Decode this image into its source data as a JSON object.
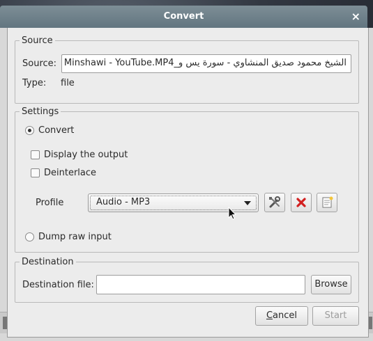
{
  "window": {
    "title": "Convert",
    "close_label": "×"
  },
  "source": {
    "group_label": "Source",
    "source_label": "Source:",
    "source_value": "الشيخ محمود صديق المنشاوي - سورة يس و_Minshawi - YouTube.MP4",
    "type_label": "Type:",
    "type_value": "file"
  },
  "settings": {
    "group_label": "Settings",
    "convert_label": "Convert",
    "convert_checked": true,
    "display_output_label": "Display the output",
    "display_output_checked": false,
    "deinterlace_label": "Deinterlace",
    "deinterlace_checked": false,
    "profile_label": "Profile",
    "profile_value": "Audio - MP3",
    "dump_raw_label": "Dump raw input",
    "dump_raw_checked": false
  },
  "destination": {
    "group_label": "Destination",
    "file_label": "Destination file:",
    "file_value": "",
    "browse_label": "Browse"
  },
  "buttons": {
    "cancel_first": "C",
    "cancel_rest": "ancel",
    "start_label": "Start"
  },
  "icons": {
    "edit_profile": "tools-icon",
    "delete_profile": "red-x-icon",
    "new_profile": "new-document-icon",
    "close": "close-icon"
  },
  "colors": {
    "titlebar": "#6f818a",
    "delete_red": "#d22020"
  }
}
